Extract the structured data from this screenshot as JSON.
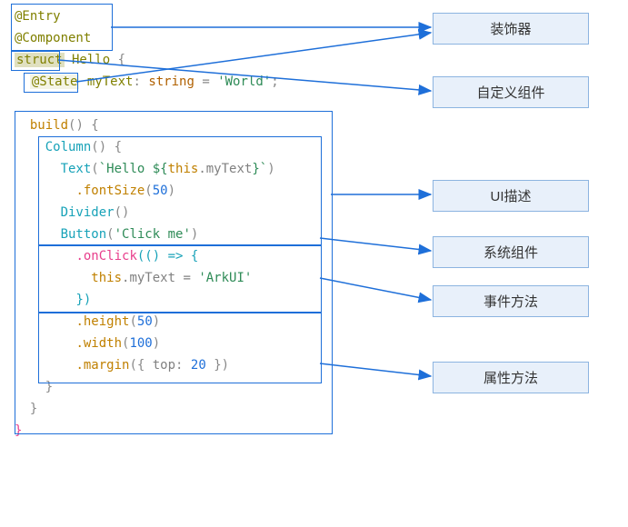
{
  "labels": {
    "decorator": "装饰器",
    "custom_component": "自定义组件",
    "ui_description": "UI描述",
    "system_component": "系统组件",
    "event_method": "事件方法",
    "attribute_method": "属性方法"
  },
  "code": {
    "l1": "@Entry",
    "l2": "@Component",
    "l3a": "struct",
    "l3b": " Hello ",
    "l3c": "{",
    "l4a": "@State",
    "l4b": " myText",
    "l4c": ": ",
    "l4d": "string",
    "l4e": " = ",
    "l4f": "'World'",
    "l4g": ";",
    "l5a": "build",
    "l5b": "() {",
    "l6a": "Column",
    "l6b": "() {",
    "l7a": "Text",
    "l7b": "(",
    "l7c": "`Hello ${",
    "l7d": "this",
    "l7e": ".myText",
    "l7f": "}`",
    "l7g": ")",
    "l8a": ".fontSize",
    "l8b": "(",
    "l8c": "50",
    "l8d": ")",
    "l9a": "Divider",
    "l9b": "()",
    "l10a": "Button",
    "l10b": "(",
    "l10c": "'Click me'",
    "l10d": ")",
    "l11a": ".onClick",
    "l11b": "(() => {",
    "l12a": "this",
    "l12b": ".myText = ",
    "l12c": "'ArkUI'",
    "l13": "})",
    "l14a": ".height",
    "l14b": "(",
    "l14c": "50",
    "l14d": ")",
    "l15a": ".width",
    "l15b": "(",
    "l15c": "100",
    "l15d": ")",
    "l16a": ".margin",
    "l16b": "({ ",
    "l16c": "top",
    "l16d": ": ",
    "l16e": "20",
    "l16f": " })",
    "l17": "}",
    "l18": "}",
    "l19": "}"
  }
}
